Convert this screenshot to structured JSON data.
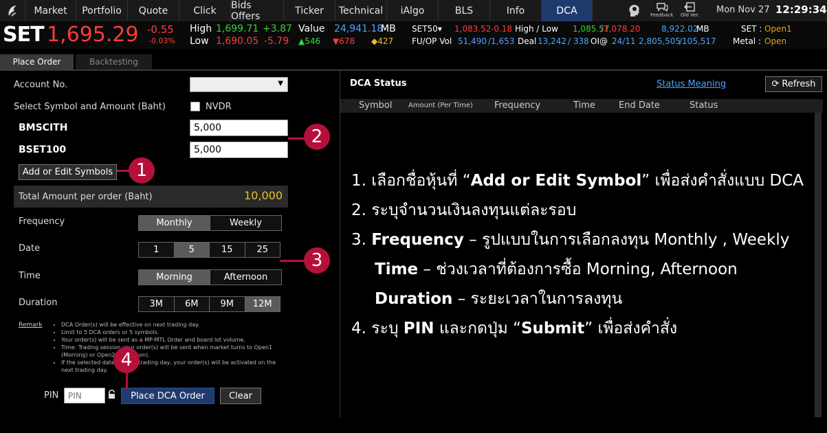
{
  "nav": {
    "items": [
      "Market",
      "Portfolio",
      "Quote",
      "Click",
      "Bids Offers",
      "Ticker",
      "Technical",
      "iAlgo",
      "BLS",
      "Info",
      "DCA"
    ],
    "active": "DCA",
    "feedback_label": "Feedback",
    "oldver_label": "Old Ver.",
    "date": "Mon Nov 27",
    "time": "12:29:34"
  },
  "market": {
    "index_name": "SET",
    "index_value": "1,695.29",
    "change": "-0.55",
    "change_pct": "-0.03%",
    "high_label": "High",
    "high_value": "1,699.71",
    "high_change": "+3.87",
    "low_label": "Low",
    "low_value": "1,690.05",
    "low_change": "-5.79",
    "value_label": "Value",
    "value_amount": "24,941.18",
    "value_unit": "MB",
    "up_count": "546",
    "down_count": "678",
    "unch_count": "427",
    "set50_label": "SET50",
    "set50_value": "1,083.52",
    "set50_change": "-0.18",
    "hl_label": "High / Low",
    "set50_high": "1,085.57",
    "set50_low": "/1,078.20",
    "set50_val": "8,922.02",
    "set50_unit": "MB",
    "fuop_label": "FU/OP Vol",
    "fuop_a": "51,490",
    "fuop_b": "/1,653",
    "deal_label": "Deal",
    "deal_a": "13,242",
    "deal_b": "/ 338",
    "oi_label": "OI@",
    "oi_a": "24/11",
    "oi_b": "2,805,505",
    "oi_c": "/105,517",
    "set_status_label": "SET :",
    "set_status": "Open1",
    "metal_label": "Metal :",
    "metal_status": "Open"
  },
  "tabs": {
    "place_order": "Place Order",
    "backtesting": "Backtesting"
  },
  "form": {
    "account_label": "Account No.",
    "symbol_amount_label": "Select Symbol and Amount (Baht)",
    "nvdr_label": "NVDR",
    "symbols": [
      {
        "name": "BMSCITH",
        "amount": "5,000"
      },
      {
        "name": "BSET100",
        "amount": "5,000"
      }
    ],
    "add_edit_button": "Add or Edit Symbols",
    "total_label": "Total Amount per order (Baht)",
    "total_value": "10,000",
    "frequency_label": "Frequency",
    "frequency_options": [
      "Monthly",
      "Weekly"
    ],
    "frequency_selected": "Monthly",
    "date_label": "Date",
    "date_options": [
      "1",
      "5",
      "15",
      "25"
    ],
    "date_selected": "5",
    "time_label": "Time",
    "time_options": [
      "Morning",
      "Afternoon"
    ],
    "time_selected": "Morning",
    "duration_label": "Duration",
    "duration_options": [
      "3M",
      "6M",
      "9M",
      "12M"
    ],
    "duration_selected": "12M",
    "remark_label": "Remark",
    "remark_items": [
      "DCA Order(s) will be effective on next trading day.",
      "Limit to 5 DCA orders or 5 symbols.",
      "Your order(s) will be sent as a MP-MTL Order and board lot volume.",
      "Time: Trading session your order(s) will be sent when market turns to Open1 (Morning) or Open2 (Afternoon).",
      "If the selected date is not a trading day, your order(s) will be activated on the next trading day."
    ],
    "pin_label": "PIN",
    "pin_placeholder": "PIN",
    "place_button": "Place DCA Order",
    "clear_button": "Clear"
  },
  "status": {
    "title": "DCA Status",
    "meaning_link": "Status Meaning",
    "refresh_button": "Refresh",
    "columns": [
      "Symbol",
      "Amount (Per Time)",
      "Frequency",
      "Time",
      "End Date",
      "Status"
    ]
  },
  "markers": [
    "1",
    "2",
    "3",
    "4"
  ],
  "instructions": {
    "l1_pre": "1. เลือกชื่อหุ้นที่ “",
    "l1_bold": "Add or Edit Symbol",
    "l1_post": "” เพื่อส่งคำสั่งแบบ DCA",
    "l2": "2. ระบุจำนวนเงินลงทุนแต่ละรอบ",
    "l3_pre": "3. ",
    "l3_bold": "Frequency",
    "l3_post": " – รูปแบบในการเลือกลงทุน Monthly , Weekly",
    "l4_bold": "Time",
    "l4_post": " – ช่วงเวลาที่ต้องการซื้อ Morning, Afternoon",
    "l5_bold": "Duration",
    "l5_post": " – ระยะเวลาในการลงทุน",
    "l6_pre": "4. ระบุ ",
    "l6_bold1": "PIN",
    "l6_mid": " และกดปุ่ม “",
    "l6_bold2": "Submit",
    "l6_post": "” เพื่อส่งคำสั่ง"
  }
}
